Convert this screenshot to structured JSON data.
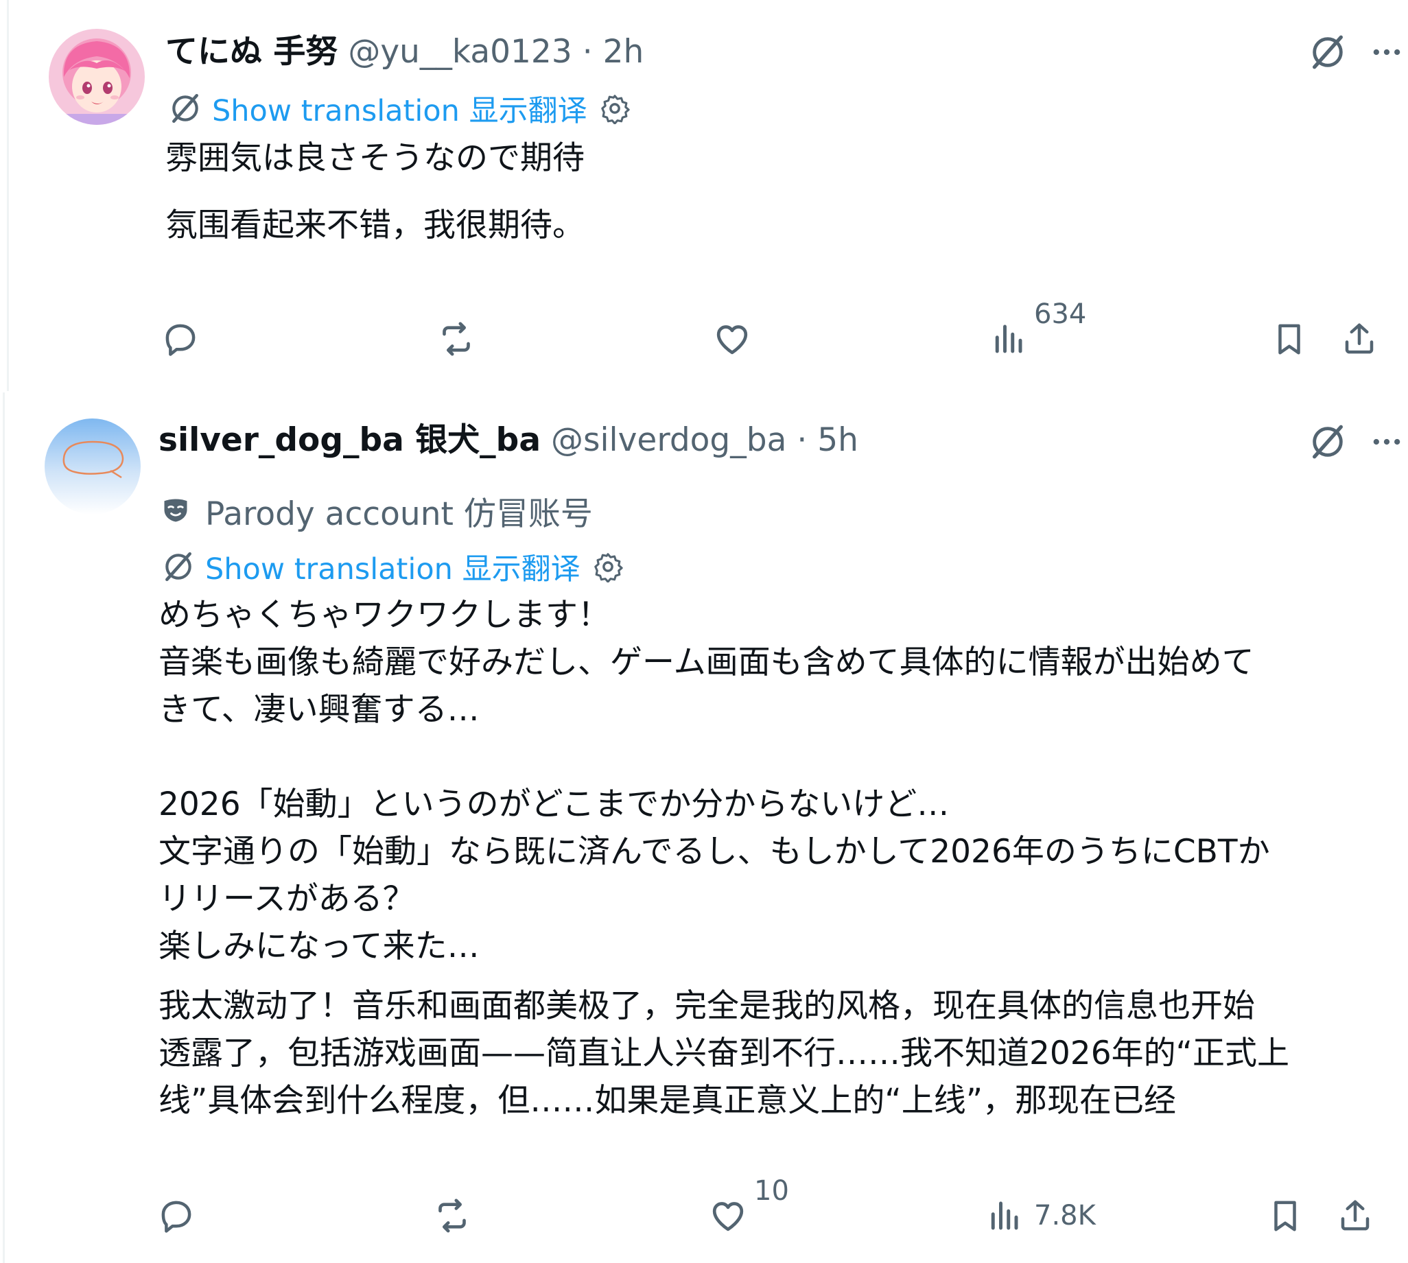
{
  "tweets": [
    {
      "display_name": "てにぬ 手努",
      "handle": "@yu__ka0123",
      "dot": "·",
      "time": "2h",
      "translate_label": "Show translation 显示翻译",
      "original_text": "雰囲気は良さそうなので期待",
      "translated_text": "氛围看起来不错，我很期待。",
      "reply_count": "",
      "retweet_count": "",
      "like_count": "",
      "view_count": "634"
    },
    {
      "display_name": "silver_dog_ba 银犬_ba",
      "handle": "@silverdog_ba",
      "dot": "·",
      "time": "5h",
      "parody_label": "Parody account 仿冒账号",
      "translate_label": "Show translation 显示翻译",
      "original_text": "めちゃくちゃワクワクします！\n音楽も画像も綺麗で好みだし、ゲーム画面も含めて具体的に情報が出始めて\nきて、凄い興奮する…\n\n2026「始動」というのがどこまでか分からないけど…\n文字通りの「始動」なら既に済んでるし、もしかして2026年のうちにCBTか\nリリースがある？\n楽しみになって来た…",
      "translated_text": "我太激动了！音乐和画面都美极了，完全是我的风格，现在具体的信息也开始\n透露了，包括游戏画面——简直让人兴奋到不行……我不知道2026年的“正式上\n线”具体会到什么程度，但……如果是真正意义上的“上线”，那现在已经",
      "reply_count": "",
      "retweet_count": "",
      "like_count": "10",
      "view_count": "7.8K"
    }
  ],
  "icons": {
    "grok": "grok-slash-icon",
    "more": "more-dots-icon",
    "translate": "translate-icon",
    "settings": "gear-icon",
    "parody": "mask-icon",
    "reply": "reply-icon",
    "retweet": "retweet-icon",
    "like": "heart-icon",
    "views": "analytics-icon",
    "bookmark": "bookmark-icon",
    "share": "share-icon"
  },
  "colors": {
    "link": "#1d9bf0",
    "secondary": "#536471",
    "text": "#0f1419"
  }
}
